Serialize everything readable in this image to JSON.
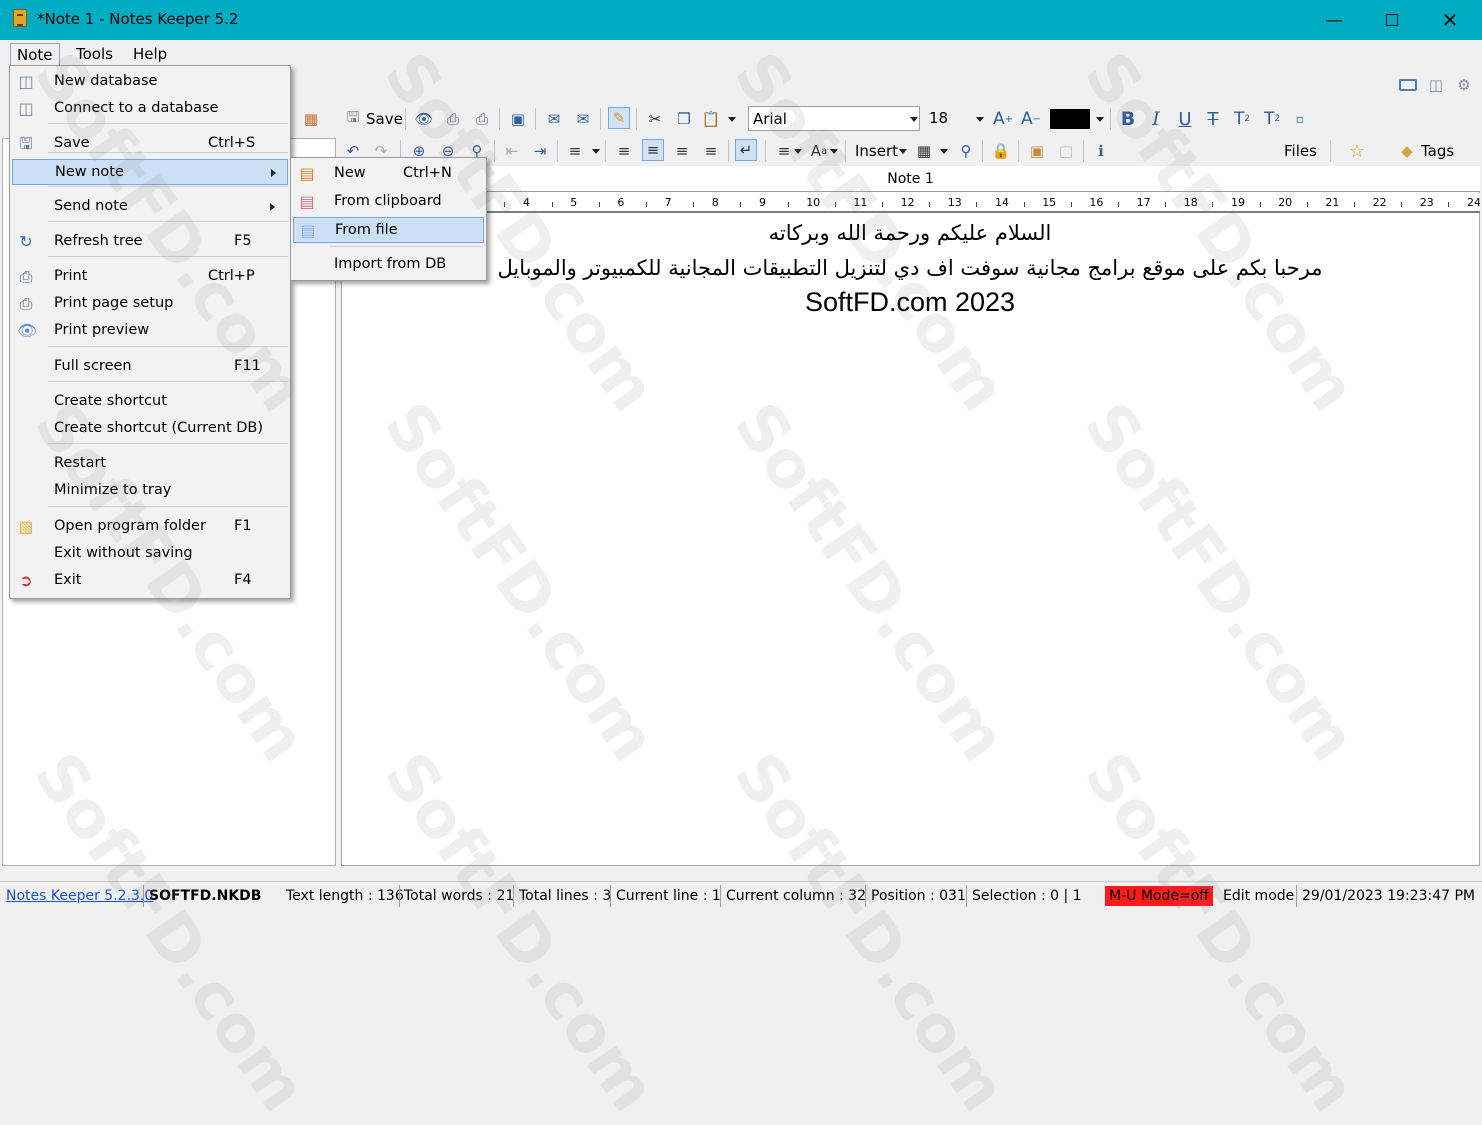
{
  "window": {
    "title": "*Note 1 - Notes Keeper 5.2"
  },
  "menubar": {
    "items": [
      "Note",
      "Tools",
      "Help"
    ]
  },
  "toolbar": {
    "save_label": "Save",
    "font_name": "Arial",
    "font_size": "18",
    "insert_label": "Insert",
    "files_label": "Files",
    "tags_label": "Tags",
    "text_color": "#000000"
  },
  "editor": {
    "tab_title": "Note 1",
    "ruler_numbers": [
      "4",
      "5",
      "6",
      "7",
      "8",
      "9",
      "10",
      "11",
      "12",
      "13",
      "14",
      "15",
      "16",
      "17",
      "18",
      "19",
      "20",
      "21",
      "22",
      "23",
      "24"
    ],
    "lines": [
      "السلام عليكم ورحمة الله وبركاته",
      "مرحبا بكم على موقع برامج مجانية سوفت اف دي لتنزيل التطبيقات المجانية للكمبيوتر والموبايل",
      "SoftFD.com 2023"
    ]
  },
  "note_menu": {
    "items": [
      {
        "label": "New database",
        "shortcut": "",
        "icon": "database-add-icon"
      },
      {
        "label": "Connect to a database",
        "shortcut": "",
        "icon": "database-icon"
      },
      {
        "label": "Save",
        "shortcut": "Ctrl+S",
        "icon": "save-icon"
      },
      {
        "label": "New note",
        "shortcut": "",
        "icon": "",
        "submenu": true
      },
      {
        "label": "Send note",
        "shortcut": "",
        "icon": "",
        "submenu": true
      },
      {
        "label": "Refresh tree",
        "shortcut": "F5",
        "icon": "refresh-icon"
      },
      {
        "label": "Print",
        "shortcut": "Ctrl+P",
        "icon": "printer-icon"
      },
      {
        "label": "Print page setup",
        "shortcut": "",
        "icon": "page-setup-icon"
      },
      {
        "label": "Print preview",
        "shortcut": "",
        "icon": "preview-icon"
      },
      {
        "label": "Full screen",
        "shortcut": "F11",
        "icon": ""
      },
      {
        "label": "Create shortcut",
        "shortcut": "",
        "icon": ""
      },
      {
        "label": "Create shortcut (Current DB)",
        "shortcut": "",
        "icon": ""
      },
      {
        "label": "Restart",
        "shortcut": "",
        "icon": ""
      },
      {
        "label": "Minimize to tray",
        "shortcut": "",
        "icon": ""
      },
      {
        "label": "Open program folder",
        "shortcut": "F1",
        "icon": "folder-icon"
      },
      {
        "label": "Exit without saving",
        "shortcut": "",
        "icon": ""
      },
      {
        "label": "Exit",
        "shortcut": "F4",
        "icon": "exit-icon"
      }
    ]
  },
  "new_note_submenu": {
    "items": [
      {
        "label": "New",
        "shortcut": "Ctrl+N"
      },
      {
        "label": "From clipboard",
        "shortcut": ""
      },
      {
        "label": "From file",
        "shortcut": ""
      },
      {
        "label": "Import from DB",
        "shortcut": ""
      }
    ]
  },
  "status": {
    "app_link": "Notes Keeper 5.2.3.0",
    "db_name": "SOFTFD.NKDB",
    "text_length": "Text length : 136",
    "total_words": "Total words : 21",
    "total_lines": "Total lines : 3",
    "current_line": "Current line : 1",
    "current_column": "Current column : 32",
    "position": "Position : 031",
    "selection": "Selection : 0 | 1",
    "mu_mode": "M-U Mode=off",
    "edit_mode": "Edit mode",
    "datetime": "29/01/2023 19:23:47 PM"
  },
  "watermark": "SoftFD.com"
}
